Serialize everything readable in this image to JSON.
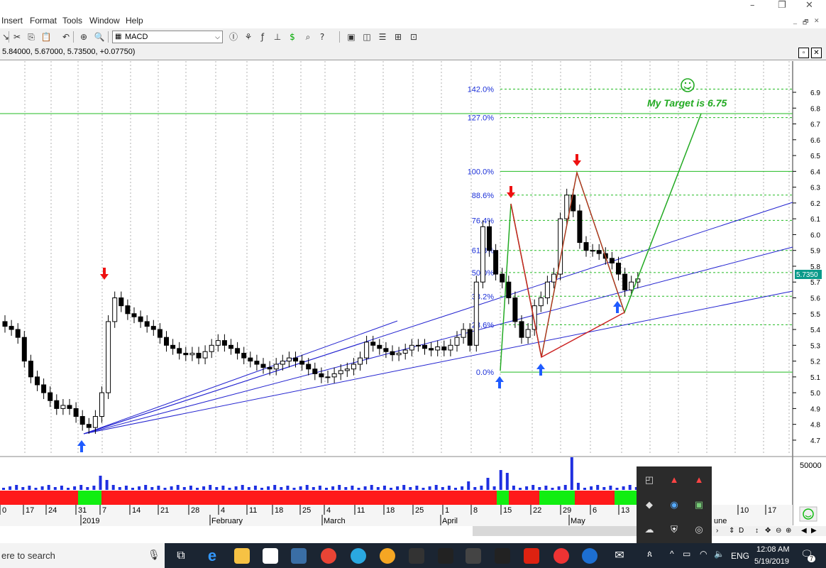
{
  "menu": [
    "Insert",
    "Format",
    "Tools",
    "Window",
    "Help"
  ],
  "toolbar": {
    "indicator_value": "MACD"
  },
  "chart_info": "5.84000, 5.67000, 5.73500, +0.07750)",
  "annotation": "My Target is 6.75",
  "current_price_label": "5.7350",
  "fib_levels": [
    {
      "label": "142.0%",
      "value": 6.92
    },
    {
      "label": "127.0%",
      "value": 6.74
    },
    {
      "label": "100.0%",
      "value": 6.4
    },
    {
      "label": "88.6%",
      "value": 6.25
    },
    {
      "label": "76.4%",
      "value": 6.09
    },
    {
      "label": "61.8%",
      "value": 5.9
    },
    {
      "label": "50.0%",
      "value": 5.76
    },
    {
      "label": "38.2%",
      "value": 5.61
    },
    {
      "label": "23.6%",
      "value": 5.43
    },
    {
      "label": "0.0%",
      "value": 5.13
    }
  ],
  "price_axis": [
    "6.9",
    "6.8",
    "6.7",
    "6.6",
    "6.5",
    "6.4",
    "6.3",
    "6.2",
    "6.1",
    "6.0",
    "5.9",
    "5.8",
    "5.7",
    "5.6",
    "5.5",
    "5.4",
    "5.3",
    "5.2",
    "5.1",
    "5.0",
    "4.9",
    "4.8",
    "4.7"
  ],
  "volume_axis": "50000",
  "date_ticks": [
    "0",
    "17",
    "24",
    "31",
    "7",
    "14",
    "21",
    "28",
    "4",
    "11",
    "18",
    "25",
    "4",
    "11",
    "18",
    "25",
    "1",
    "8",
    "15",
    "22",
    "29",
    "6",
    "13",
    "10",
    "17"
  ],
  "month_labels": [
    "2019",
    "February",
    "March",
    "April",
    "May"
  ],
  "partial_june": "une",
  "taskbar": {
    "search_placeholder": "ere to search",
    "language": "ENG",
    "time": "12:08 AM",
    "date": "5/19/2019",
    "notification_count": "7"
  },
  "colors": {
    "fib_line": "#22bb22",
    "fib_label": "#1a2fd8",
    "fan_line": "#2424d0",
    "harmonic_green": "#22aa22",
    "harmonic_red": "#cc2222",
    "arrow_red": "#e11",
    "arrow_blue": "#1f5bff",
    "macd_red": "#ff1a1a",
    "macd_green": "#11ee11",
    "volume": "#1f2fe0"
  }
}
